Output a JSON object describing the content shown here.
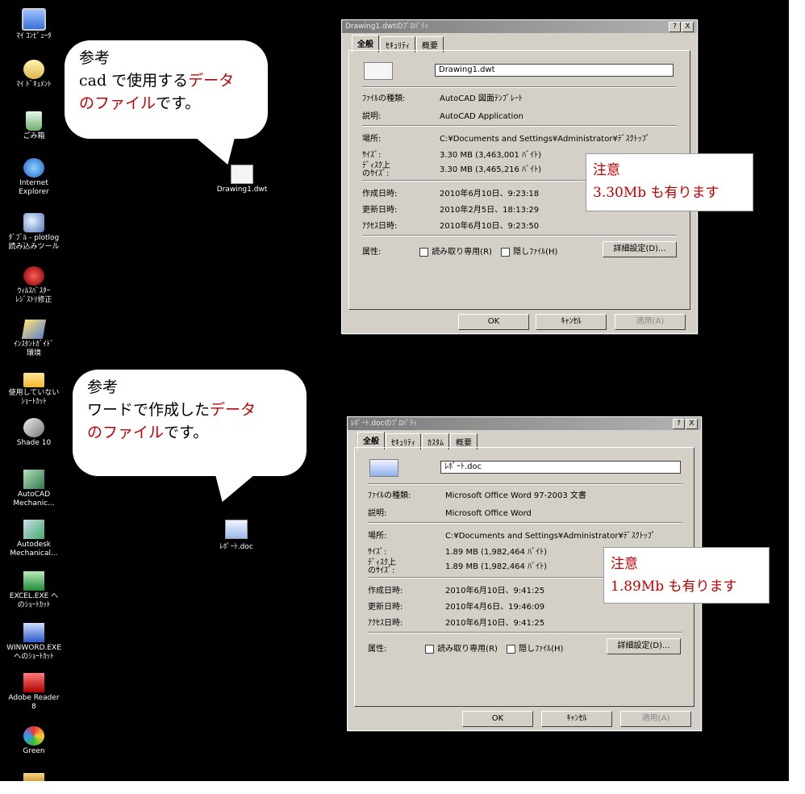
{
  "desktop_icons": [
    {
      "label": "ﾏｲ ｺﾝﾋﾟｭｰﾀ",
      "icon": "computer-icon"
    },
    {
      "label": "ﾏｲ ﾄﾞｷｭﾒﾝﾄ",
      "icon": "my-documents-icon"
    },
    {
      "label": "ごみ箱",
      "icon": "recycle-bin-icon"
    },
    {
      "label": "Internet\nExplorer",
      "icon": "internet-explorer-icon"
    },
    {
      "label": "ﾀﾞﾌﾞﾙ - plotlog\n読み込みツール",
      "icon": "search-tool-icon"
    },
    {
      "label": "ｳｨﾙｽﾊﾞｽﾀｰ\nﾚｼﾞｽﾄﾘ修正",
      "icon": "ladybug-icon"
    },
    {
      "label": "ｲﾝｽﾀﾝﾄｶﾞｲﾄﾞ\n環境",
      "icon": "tools-icon"
    },
    {
      "label": "使用していない\nｼｮｰﾄｶｯﾄ",
      "icon": "folder-icon"
    },
    {
      "label": "Shade 10",
      "icon": "shade-icon"
    },
    {
      "label": "AutoCAD\nMechanic...",
      "icon": "autocad-icon"
    },
    {
      "label": "Autodesk\nMechanical...",
      "icon": "autodesk-icon"
    },
    {
      "label": "EXCEL.EXE へ\nのｼｮｰﾄｶｯﾄ",
      "icon": "excel-icon"
    },
    {
      "label": "WINWORD.EXE\nへのｼｮｰﾄｶｯﾄ",
      "icon": "word-icon"
    },
    {
      "label": "Adobe Reader\n8",
      "icon": "adobe-reader-icon"
    },
    {
      "label": "Green",
      "icon": "green-icon"
    },
    {
      "label": "",
      "icon": "partial-icon"
    }
  ],
  "files": [
    {
      "label": "Drawing1.dwt",
      "icon": "dwt-file-icon"
    },
    {
      "label": "ﾚﾎﾟｰﾄ.doc",
      "icon": "word-file-icon"
    }
  ],
  "callouts": [
    {
      "head": "参考",
      "line2_plain": "cad で使用する",
      "line2_red": "データ",
      "line3_red": "のファイル",
      "line3_plain": "です。"
    },
    {
      "head": "参考",
      "line2_plain": "ワードで作成した",
      "line2_red": "データ",
      "line3_red": "のファイル",
      "line3_plain": "です。"
    }
  ],
  "dialog1": {
    "title": "Drawing1.dwtのﾌﾟﾛﾊﾟﾃｨ",
    "tabs": [
      "全般",
      "ｾｷｭﾘﾃｨ",
      "概要"
    ],
    "filename": "Drawing1.dwt",
    "rows": [
      {
        "label": "ﾌｧｲﾙの種類:",
        "value": "AutoCAD 図面ﾃﾝﾌﾟﾚｰﾄ"
      },
      {
        "label": "説明:",
        "value": "AutoCAD Application"
      },
      {
        "label": "場所:",
        "value": "C:¥Documents and Settings¥Administrator¥ﾃﾞｽｸﾄｯﾌﾟ"
      },
      {
        "label": "ｻｲｽﾞ:",
        "value": "3.30 MB (3,463,001 ﾊﾞｲﾄ)"
      },
      {
        "label": "ﾃﾞｨｽｸ上\nのｻｲｽﾞ:",
        "value": "3.30 MB (3,465,216 ﾊﾞｲﾄ)"
      },
      {
        "label": "作成日時:",
        "value": "2010年6月10日、9:23:18"
      },
      {
        "label": "更新日時:",
        "value": "2010年2月5日、18:13:29"
      },
      {
        "label": "ｱｸｾｽ日時:",
        "value": "2010年6月10日、9:23:50"
      }
    ],
    "attr_label": "属性:",
    "readonly_label": "読み取り専用(R)",
    "hidden_label": "隠しﾌｧｲﾙ(H)",
    "details_button": "詳細設定(D)...",
    "ok": "OK",
    "cancel": "ｷｬﾝｾﾙ",
    "apply": "適用(A)",
    "help": "?",
    "close": "X"
  },
  "dialog2": {
    "title": "ﾚﾎﾟｰﾄ.docのﾌﾟﾛﾊﾟﾃｨ",
    "tabs": [
      "全般",
      "ｾｷｭﾘﾃｨ",
      "ｶｽﾀﾑ",
      "概要"
    ],
    "filename": "ﾚﾎﾟｰﾄ.doc",
    "rows": [
      {
        "label": "ﾌｧｲﾙの種類:",
        "value": "Microsoft Office Word 97-2003 文書"
      },
      {
        "label": "説明:",
        "value": "Microsoft Office Word"
      },
      {
        "label": "場所:",
        "value": "C:¥Documents and Settings¥Administrator¥ﾃﾞｽｸﾄｯﾌﾟ"
      },
      {
        "label": "ｻｲｽﾞ:",
        "value": "1.89 MB (1,982,464 ﾊﾞｲﾄ)"
      },
      {
        "label": "ﾃﾞｨｽｸ上\nのｻｲｽﾞ:",
        "value": "1.89 MB (1,982,464 ﾊﾞｲﾄ)"
      },
      {
        "label": "作成日時:",
        "value": "2010年6月10日、9:41:25"
      },
      {
        "label": "更新日時:",
        "value": "2010年4月6日、19:46:09"
      },
      {
        "label": "ｱｸｾｽ日時:",
        "value": "2010年6月10日、9:41:25"
      }
    ],
    "attr_label": "属性:",
    "readonly_label": "読み取り専用(R)",
    "hidden_label": "隠しﾌｧｲﾙ(H)",
    "details_button": "詳細設定(D)...",
    "ok": "OK",
    "cancel": "ｷｬﾝｾﾙ",
    "apply": "適用(A)",
    "help": "?",
    "close": "X"
  },
  "notes": [
    {
      "line1": "注意",
      "line2": "3.30Mb も有ります"
    },
    {
      "line1": "注意",
      "line2": "1.89Mb も有ります"
    }
  ]
}
